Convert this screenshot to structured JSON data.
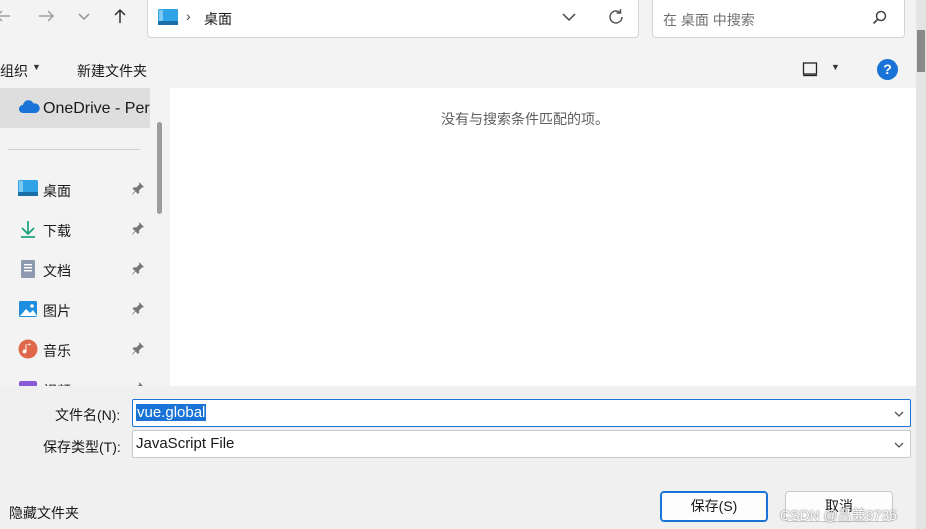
{
  "address": {
    "path": "桌面"
  },
  "search": {
    "placeholder": "在 桌面 中搜索"
  },
  "toolbar": {
    "organize_label": "组织",
    "new_folder_label": "新建文件夹"
  },
  "nav": {
    "onedrive_label": "OneDrive - Per",
    "items": [
      {
        "label": "桌面",
        "icon": "desktop-icon"
      },
      {
        "label": "下载",
        "icon": "download-icon"
      },
      {
        "label": "文档",
        "icon": "document-icon"
      },
      {
        "label": "图片",
        "icon": "pictures-icon"
      },
      {
        "label": "音乐",
        "icon": "music-icon"
      },
      {
        "label": "视频",
        "icon": "video-icon"
      }
    ]
  },
  "content": {
    "empty_message": "没有与搜索条件匹配的项。"
  },
  "form": {
    "filename_label": "文件名(N):",
    "filename_value": "vue.global",
    "filetype_label": "保存类型(T):",
    "filetype_value": "JavaScript File",
    "hide_folders_label": "隐藏文件夹",
    "save_label": "保存(S)",
    "cancel_label": "取消"
  },
  "watermark": "CSDN @吕兼9735",
  "colors": {
    "accent": "#1a73d6",
    "folder": "#2fa3e6"
  }
}
